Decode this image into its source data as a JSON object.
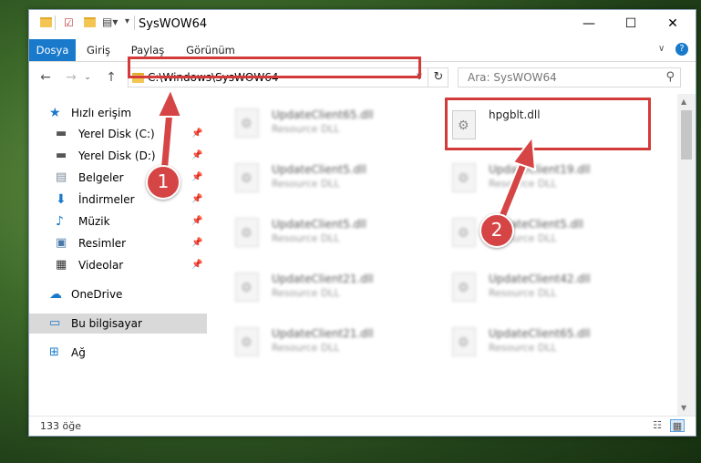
{
  "window": {
    "title": "SysWOW64"
  },
  "ribbon": {
    "tabs": [
      "Dosya",
      "Giriş",
      "Paylaş",
      "Görünüm"
    ]
  },
  "address": {
    "path": "C:\\Windows\\SysWOW64"
  },
  "search": {
    "placeholder": "Ara: SysWOW64"
  },
  "nav": {
    "items": [
      {
        "label": "Hızlı erişim",
        "icon": "star-icon"
      },
      {
        "label": "Yerel Disk (C:)",
        "icon": "drive-icon"
      },
      {
        "label": "Yerel Disk (D:)",
        "icon": "drive-icon"
      },
      {
        "label": "Belgeler",
        "icon": "documents-icon"
      },
      {
        "label": "İndirmeler",
        "icon": "download-icon"
      },
      {
        "label": "Müzik",
        "icon": "music-icon"
      },
      {
        "label": "Resimler",
        "icon": "pictures-icon"
      },
      {
        "label": "Videolar",
        "icon": "videos-icon"
      },
      {
        "label": "OneDrive",
        "icon": "cloud-icon"
      },
      {
        "label": "Bu bilgisayar",
        "icon": "computer-icon"
      },
      {
        "label": "Ağ",
        "icon": "network-icon"
      }
    ]
  },
  "files": [
    {
      "name": "UpdateClient65.dll",
      "type": "Resource DLL"
    },
    {
      "name": "hpgblt.dll",
      "type": ""
    },
    {
      "name": "UpdateClient5.dll",
      "type": "Resource DLL"
    },
    {
      "name": "UpdateClient19.dll",
      "type": "Resource DLL"
    },
    {
      "name": "UpdateClient5.dll",
      "type": "Resource DLL"
    },
    {
      "name": "UpdateClient5.dll",
      "type": "Resource DLL"
    },
    {
      "name": "UpdateClient21.dll",
      "type": "Resource DLL"
    },
    {
      "name": "UpdateClient42.dll",
      "type": "Resource DLL"
    },
    {
      "name": "UpdateClient21.dll",
      "type": "Resource DLL"
    },
    {
      "name": "UpdateClient65.dll",
      "type": "Resource DLL"
    }
  ],
  "status": {
    "count": "133 öğe"
  },
  "annotations": {
    "badge1": "1",
    "badge2": "2"
  },
  "colors": {
    "accent": "#1979ca",
    "highlight": "#d33b3b"
  }
}
